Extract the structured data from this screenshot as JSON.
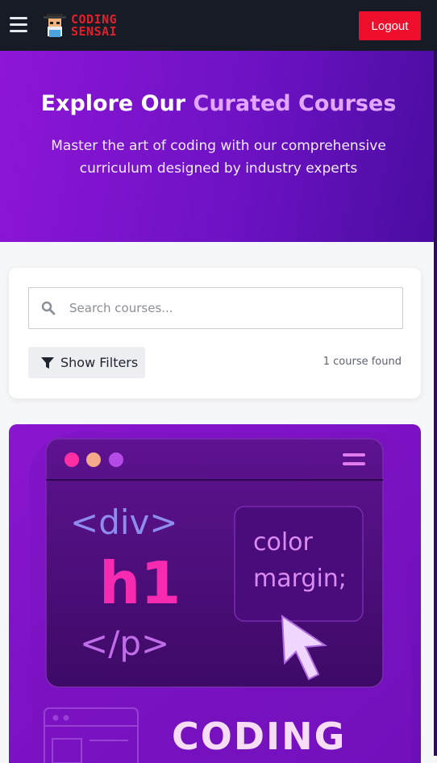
{
  "header": {
    "logo_line1": "CODING",
    "logo_line2": "SENSAI",
    "logout_label": "Logout"
  },
  "hero": {
    "title_main": "Explore Our ",
    "title_accent": "Curated Courses",
    "subtitle": "Master the art of coding with our comprehensive curriculum designed by industry experts"
  },
  "search": {
    "placeholder": "Search courses...",
    "filter_label": "Show Filters",
    "results_count": "1 course found"
  },
  "course_image": {
    "tag_open": "<div>",
    "tag_h1": "h1",
    "tag_close": "</p>",
    "css_line1": "color",
    "css_line2": "margin;",
    "banner_text": "CODING"
  },
  "colors": {
    "header_bg": "#161b26",
    "logout_bg": "#ef0f2c",
    "accent": "#e2a6ff",
    "hero_start": "#8e16d6",
    "hero_end": "#4a0ca0"
  }
}
